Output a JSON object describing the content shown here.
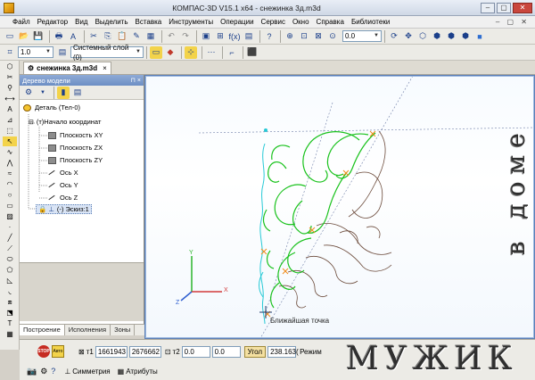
{
  "window": {
    "title": "КОМПАС-3D V15.1 x64 - снежинка 3д.m3d"
  },
  "menu": [
    "Файл",
    "Редактор",
    "Вид",
    "Выделить",
    "Вставка",
    "Инструменты",
    "Операции",
    "Сервис",
    "Окно",
    "Справка",
    "Библиотеки"
  ],
  "toolbar": {
    "zoom_value": "0.0",
    "step_value": "1.0",
    "layer_value": "Системный слой (0)"
  },
  "document_tab": {
    "label": "снежинка 3д.m3d",
    "close": "×"
  },
  "tree": {
    "header": "Дерево модели",
    "pins": "⊓ ×",
    "nodes": [
      {
        "label": "Деталь (Тел-0)",
        "kind": "part"
      },
      {
        "label": "(т)Начало координат",
        "kind": "origin"
      },
      {
        "label": "Плоскость XY",
        "kind": "plane"
      },
      {
        "label": "Плоскость ZX",
        "kind": "plane"
      },
      {
        "label": "Плоскость ZY",
        "kind": "plane"
      },
      {
        "label": "Ось X",
        "kind": "axis"
      },
      {
        "label": "Ось Y",
        "kind": "axis"
      },
      {
        "label": "Ось Z",
        "kind": "axis"
      },
      {
        "label": "(-) Эскиз:1",
        "kind": "sketch"
      }
    ],
    "tabs": [
      "Построение",
      "Исполнения",
      "Зоны"
    ]
  },
  "viewport": {
    "hint": "Ближайшая точка",
    "axis_labels": {
      "x": "X",
      "y": "Y",
      "z": "Z"
    }
  },
  "bottom_panel": {
    "t1_label": "т1",
    "t1_x": "1661943",
    "t1_y": "2676662",
    "t2_label": "т2",
    "t2_x": "0.0",
    "t2_y": "0.0",
    "angle_label": "Угол",
    "angle_value": "238.163(",
    "mode_label": "Режим",
    "stop_label": "STOP",
    "auto_label": "Авто",
    "tabs": [
      "Симметрия",
      "Атрибуты"
    ]
  },
  "watermark": {
    "vertical": "в доме",
    "horizontal": "МУЖИК"
  },
  "colors": {
    "sketch_green": "#19c21c",
    "selection_cyan": "#27c9d6",
    "curve_brown": "#6b4a3a",
    "orange_marker": "#f08b1a",
    "viewport_frame": "#5b7fb6"
  }
}
